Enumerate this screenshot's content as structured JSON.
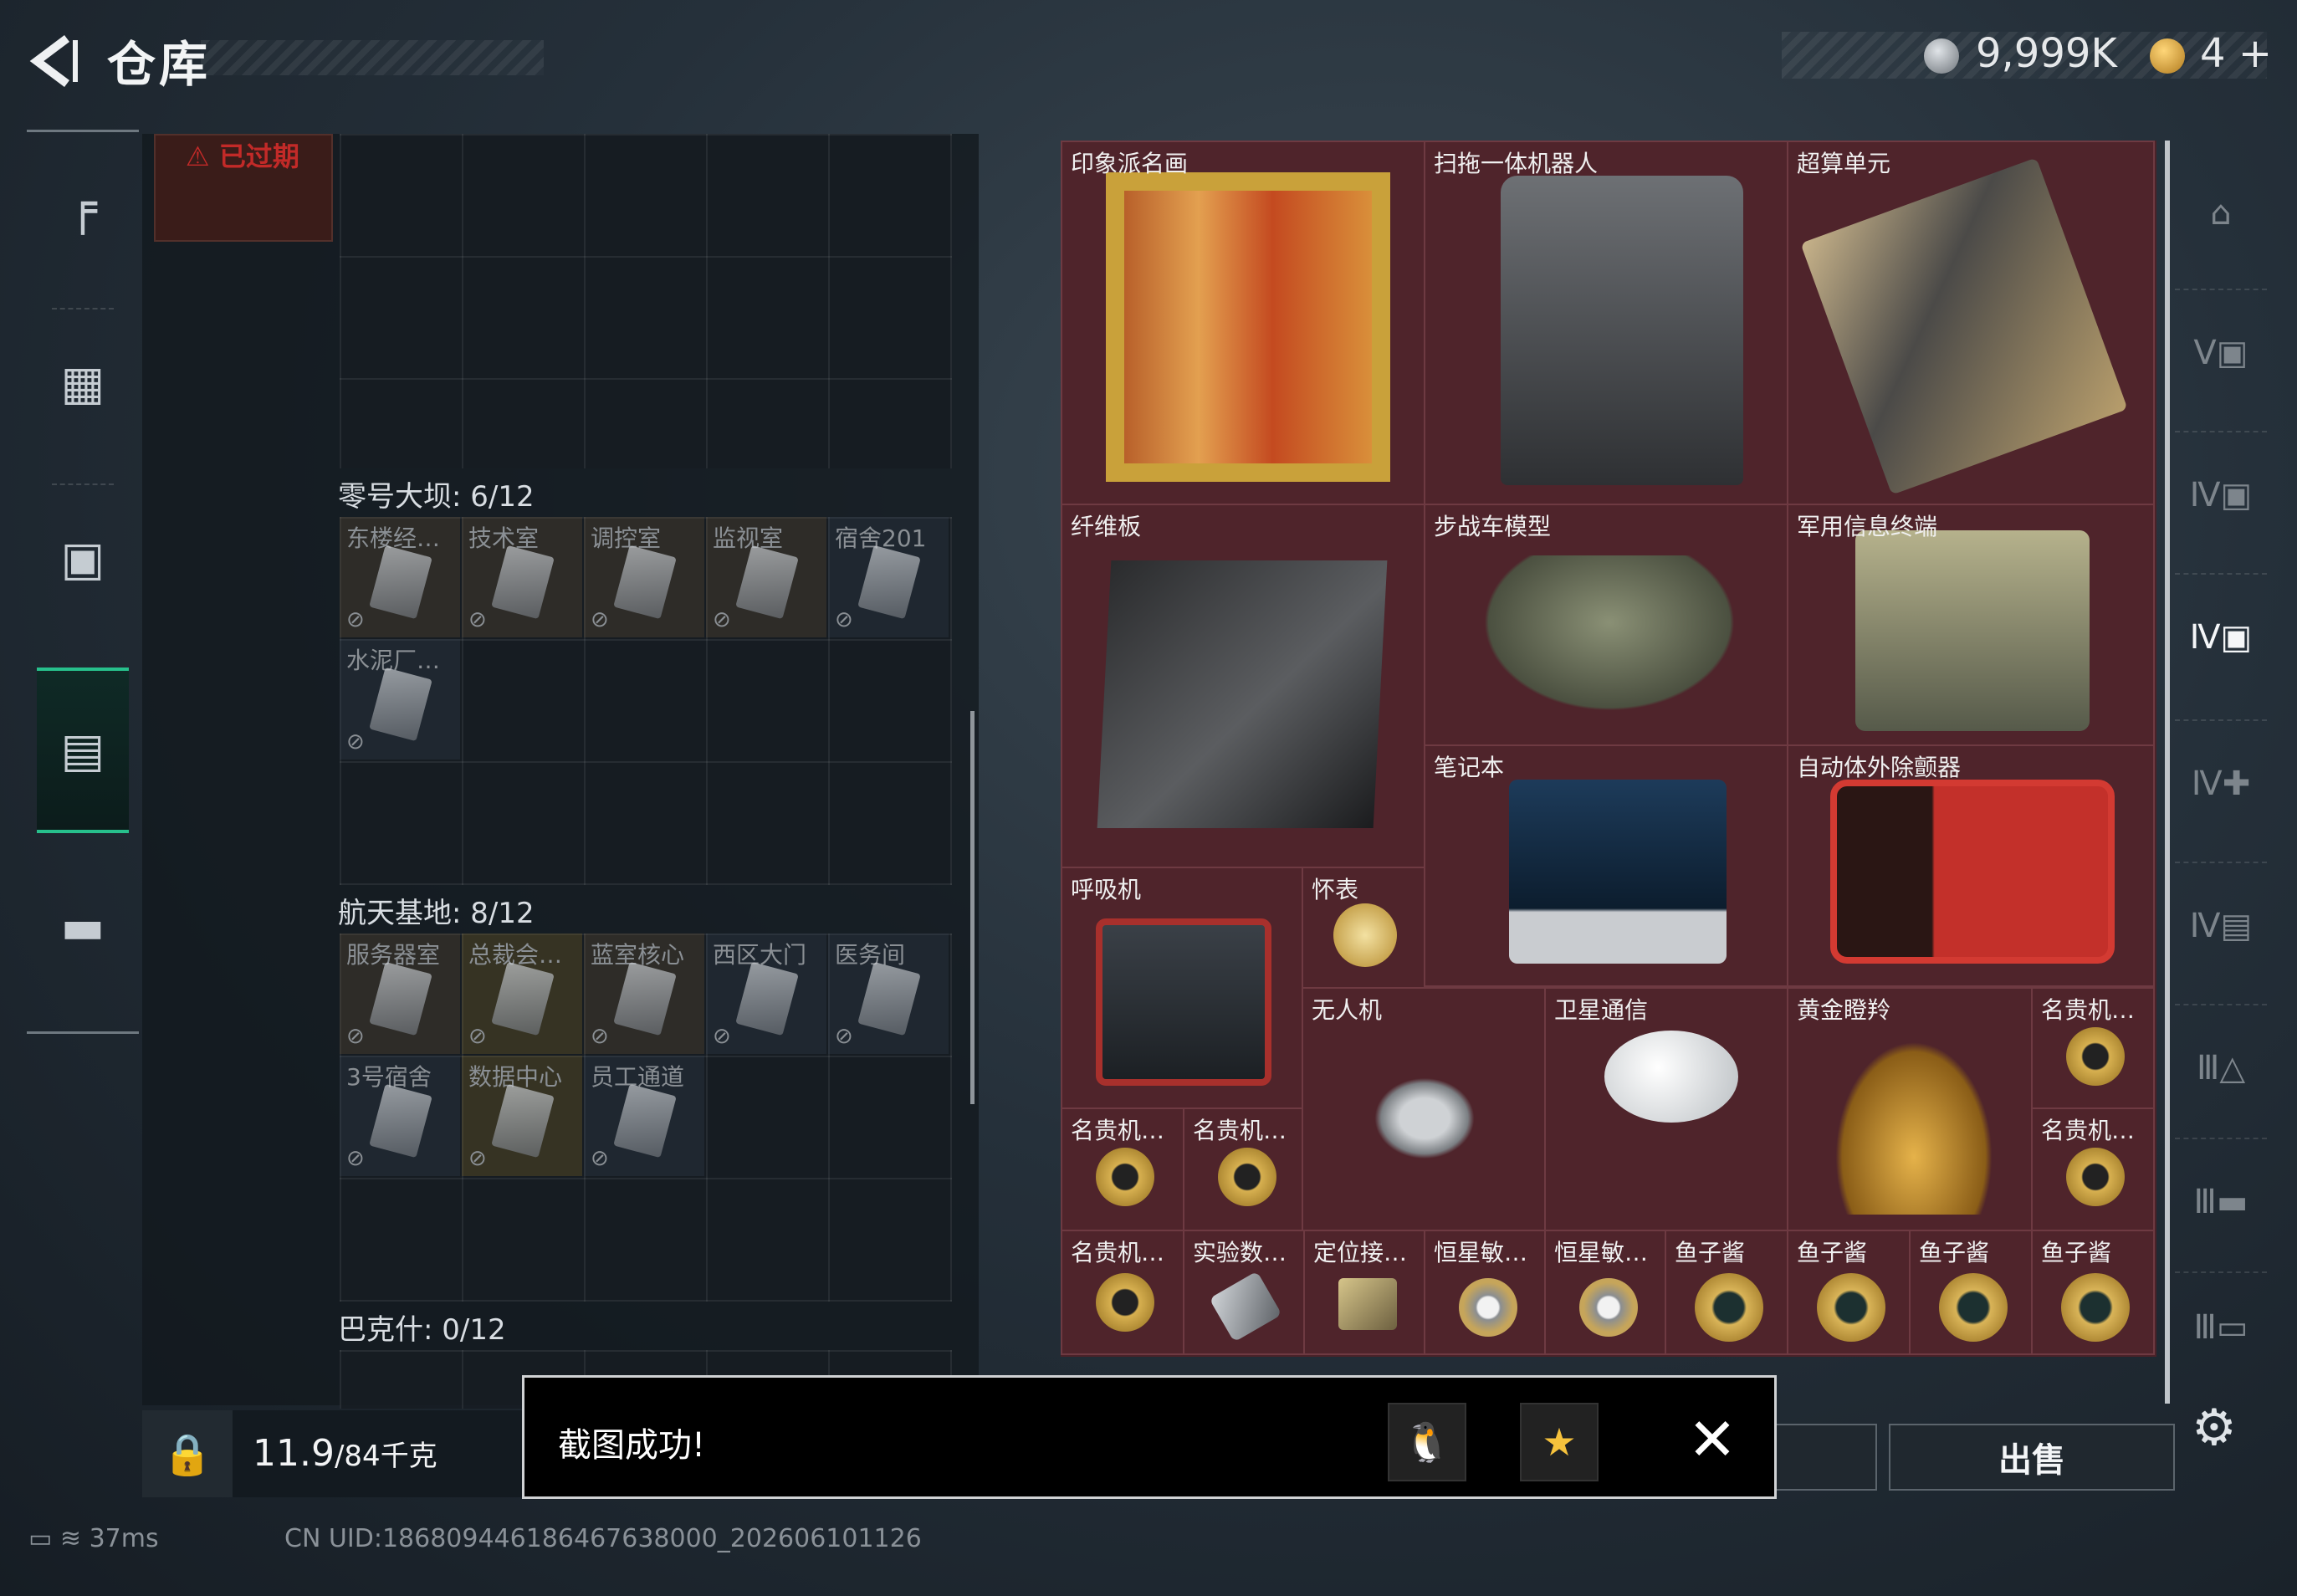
{
  "header": {
    "title": "仓库",
    "silver_amount": "9,999K",
    "gold_amount": "4",
    "gold_plus": "+"
  },
  "left_nav": {
    "items": [
      {
        "icon": "pistol-icon"
      },
      {
        "icon": "vest-icon"
      },
      {
        "icon": "backpack-icon"
      },
      {
        "icon": "storage-box-icon",
        "active": true
      },
      {
        "icon": "briefcase-icon"
      }
    ]
  },
  "left_panel": {
    "expired_label": "已过期",
    "sections": [
      {
        "title": "零号大坝: 6/12",
        "slots": [
          "东楼经…",
          "技术室",
          "调控室",
          "监视室",
          "宿舍201",
          "水泥厂…"
        ]
      },
      {
        "title": "航天基地: 8/12",
        "slots": [
          "服务器室",
          "总裁会…",
          "蓝室核心",
          "西区大门",
          "医务间",
          "3号宿舍",
          "数据中心",
          "员工通道"
        ]
      },
      {
        "title": "巴克什: 0/12",
        "slots": []
      }
    ]
  },
  "inventory": {
    "items": [
      {
        "name": "印象派名画",
        "icon": "painting-icon"
      },
      {
        "name": "扫拖一体机器人",
        "icon": "robot-vacuum-icon"
      },
      {
        "name": "超算单元",
        "icon": "supercomputer-unit-icon"
      },
      {
        "name": "纤维板",
        "icon": "fiberboard-icon"
      },
      {
        "name": "步战车模型",
        "icon": "ifv-model-icon"
      },
      {
        "name": "军用信息终端",
        "icon": "military-terminal-icon"
      },
      {
        "name": "笔记本",
        "icon": "laptop-icon"
      },
      {
        "name": "自动体外除颤器",
        "icon": "defibrillator-icon"
      },
      {
        "name": "呼吸机",
        "icon": "ventilator-icon"
      },
      {
        "name": "怀表",
        "icon": "pocket-watch-icon"
      },
      {
        "name": "无人机",
        "icon": "drone-icon"
      },
      {
        "name": "卫星通信",
        "icon": "satellite-dish-icon"
      },
      {
        "name": "黄金瞪羚",
        "icon": "golden-gazelle-icon"
      },
      {
        "name": "名贵机…",
        "icon": "watch-icon"
      },
      {
        "name": "名贵机…",
        "icon": "watch-icon"
      },
      {
        "name": "名贵机…",
        "icon": "watch-icon"
      },
      {
        "name": "名贵机…",
        "icon": "watch-icon"
      },
      {
        "name": "名贵机…",
        "icon": "watch-icon"
      },
      {
        "name": "实验数…",
        "icon": "data-device-icon"
      },
      {
        "name": "定位接…",
        "icon": "locator-icon"
      },
      {
        "name": "恒星敏…",
        "icon": "star-sensor-icon"
      },
      {
        "name": "恒星敏…",
        "icon": "star-sensor-icon"
      },
      {
        "name": "鱼子酱",
        "icon": "caviar-icon"
      },
      {
        "name": "鱼子酱",
        "icon": "caviar-icon"
      },
      {
        "name": "鱼子酱",
        "icon": "caviar-icon"
      },
      {
        "name": "鱼子酱",
        "icon": "caviar-icon"
      }
    ]
  },
  "bottom": {
    "weight_current": "11.9",
    "weight_max": "/84千克",
    "sell_label": "出售"
  },
  "toast": {
    "message": "截图成功!"
  },
  "status": {
    "ping": "37ms",
    "uid": "CN UID:18680944618646763800​0_202606101126"
  },
  "colors": {
    "accent": "#27c08c",
    "inventory_bg": "#4a2229",
    "expired": "#c22a28"
  }
}
